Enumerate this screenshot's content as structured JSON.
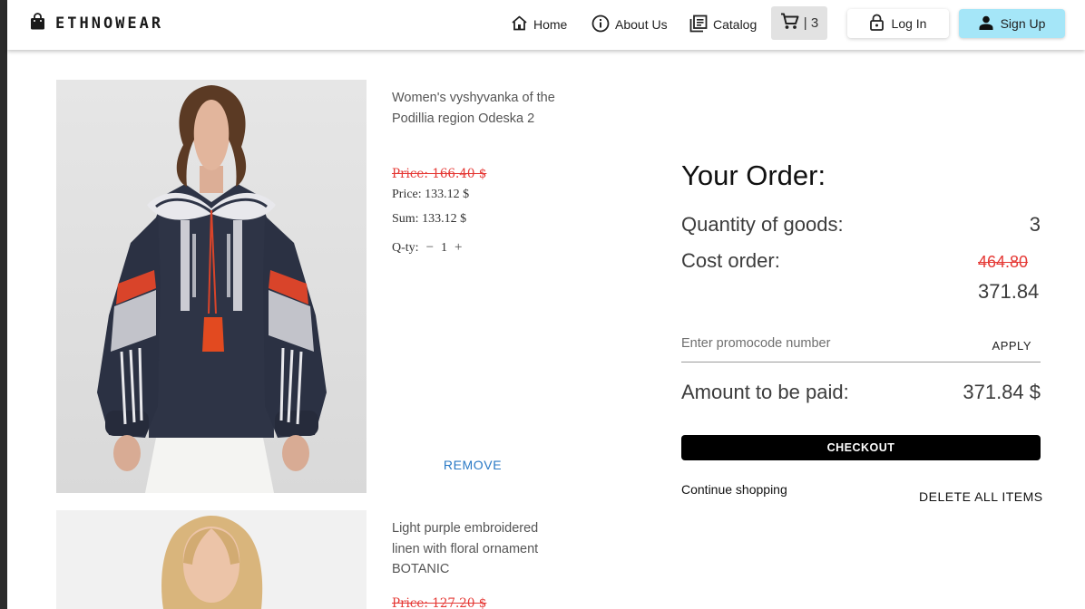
{
  "brand": {
    "name": "ETHNOWEAR",
    "icon": "shopping-bag-icon"
  },
  "nav": {
    "home": {
      "label": "Home",
      "icon": "home-icon"
    },
    "about": {
      "label": "About Us",
      "icon": "info-icon"
    },
    "catalog": {
      "label": "Catalog",
      "icon": "catalog-icon"
    },
    "cart": {
      "icon": "cart-icon",
      "count": "| 3"
    },
    "login": {
      "label": "Log In",
      "icon": "lock-icon"
    },
    "signup": {
      "label": "Sign Up",
      "icon": "person-icon"
    }
  },
  "products": [
    {
      "title": "Women's vyshyvanka of the Podillia region Odeska 2",
      "old_price": "Price: 166.40 $",
      "price": "Price: 133.12 $",
      "sum": "Sum: 133.12 $",
      "qty_label": "Q-ty:",
      "qty_minus": "−",
      "qty": "1",
      "qty_plus": "+",
      "remove_label": "REMOVE"
    },
    {
      "title": "Light purple embroidered linen with floral ornament BOTANIC",
      "old_price": "Price: 127.20 $"
    }
  ],
  "order": {
    "title": "Your Order:",
    "qty_label": "Quantity of goods:",
    "qty_value": "3",
    "cost_label": "Cost order:",
    "cost_old": "464.80",
    "cost_new": "371.84",
    "promo_placeholder": "Enter promocode number",
    "apply_label": "APPLY",
    "pay_label": "Amount to be paid:",
    "pay_value": "371.84 $",
    "checkout_label": "CHECKOUT",
    "continue_label": "Continue shopping",
    "delete_all_label": "DELETE ALL ITEMS"
  },
  "colors": {
    "accent": "#a5e6f8",
    "strike": "#e53935",
    "link": "#2979c5",
    "checkout": "#000000"
  }
}
